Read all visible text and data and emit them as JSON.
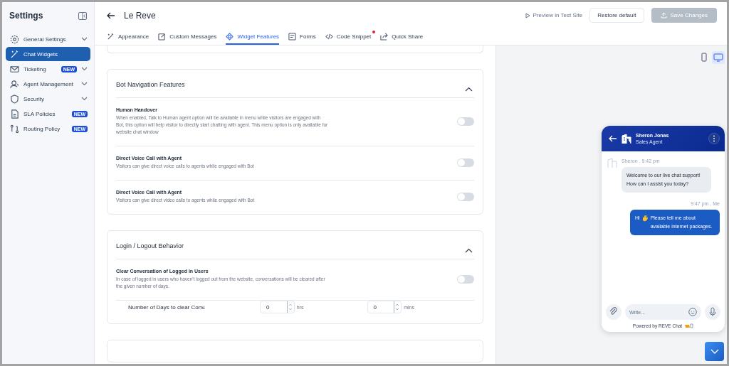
{
  "sidebar": {
    "title": "Settings",
    "items": [
      {
        "label": "General Settings",
        "selected": false,
        "expandable": true
      },
      {
        "label": "Chat Widgets",
        "selected": true,
        "expandable": false
      },
      {
        "label": "Ticketing",
        "selected": false,
        "expandable": true,
        "badge": "NEW"
      },
      {
        "label": "Agent Management",
        "selected": false,
        "expandable": true
      },
      {
        "label": "Security",
        "selected": false,
        "expandable": true
      },
      {
        "label": "SLA Policies",
        "selected": false,
        "expandable": false,
        "badge": "NEW"
      },
      {
        "label": "Routing Policy",
        "selected": false,
        "expandable": false,
        "badge": "NEW"
      }
    ]
  },
  "header": {
    "title": "Le Reve",
    "preview": "Preview in Test Site",
    "restore": "Restore default",
    "save": "Save Changes",
    "save_disabled": true
  },
  "tabs": [
    {
      "label": "Appearance",
      "selected": false,
      "dot": false
    },
    {
      "label": "Custom Messages",
      "selected": false,
      "dot": false
    },
    {
      "label": "Widget Features",
      "selected": true,
      "dot": false
    },
    {
      "label": "Forms",
      "selected": false,
      "dot": false
    },
    {
      "label": "Code Snippet",
      "selected": false,
      "dot": true
    },
    {
      "label": "Quick Share",
      "selected": false,
      "dot": false
    }
  ],
  "sections": [
    {
      "title": "Bot Navigation Features",
      "expanded": true,
      "settings": [
        {
          "name": "Human Handover",
          "description": "When enabled, Talk to Human agent option will be available in menu while visitors are engaged with Bot, this option will help visitor to directly start chatting with agent. This menu option is only available for website chat window",
          "on": false
        },
        {
          "name": "Direct Voice Call with Agent",
          "description": "Visitors can give direct voice calls to agents while engaged with Bot",
          "on": false
        },
        {
          "name": "Direct Voice Call with Agent",
          "description": "Visitors can give direct video calls to agents while engaged with Bot",
          "on": false
        }
      ]
    },
    {
      "title": "Login / Logout Behavior",
      "expanded": true,
      "settings": [
        {
          "name": "Clear Conversation of Logged in Users",
          "description": "In case of logged in users who haven't logged out from the website, conversations will be cleared after the given number of days.",
          "on": false
        }
      ],
      "days_row": {
        "label": "Number of Days to clear Conv.",
        "hours": "0",
        "hours_unit": "hrs",
        "minutes": "0",
        "minutes_unit": "mins"
      }
    }
  ],
  "preview": {
    "devices": [
      {
        "selected": false
      },
      {
        "selected": true
      }
    ],
    "agent_name": "Sheron Jonas",
    "agent_role": "Sales Agent",
    "messages": [
      {
        "kind": "agent",
        "meta": "Sheron . 9:42 pm",
        "text": "Welcome to our live chat support! How can I assist you today?"
      },
      {
        "kind": "visitor",
        "meta": "9:47 pm . Me",
        "greeting": "Hi",
        "text": "Please tell me about available internet packages."
      }
    ],
    "input_placeholder": "Write...",
    "powered_by": "Powered by REVE Chat"
  }
}
